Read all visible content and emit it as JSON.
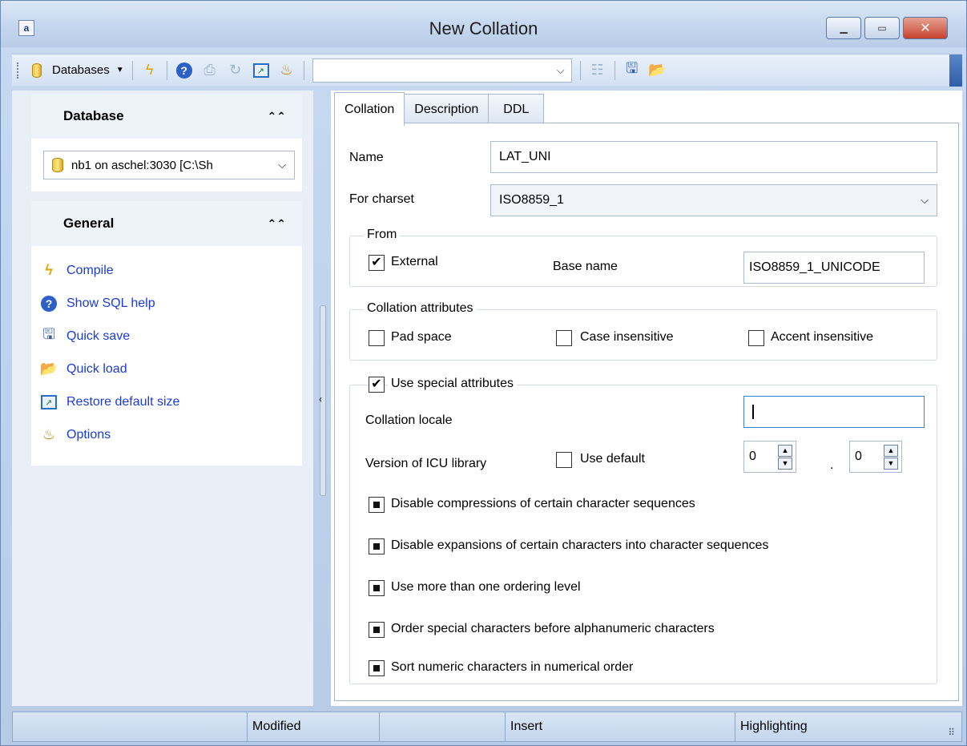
{
  "window": {
    "title": "New Collation"
  },
  "toolbar": {
    "databases_label": "Databases",
    "combo_value": ""
  },
  "left": {
    "database_section": "Database",
    "database_value": "nb1 on aschel:3030 [C:\\Sh",
    "general_section": "General",
    "links": [
      "Compile",
      "Show SQL help",
      "Quick save",
      "Quick load",
      "Restore default size",
      "Options"
    ]
  },
  "tabs": [
    "Collation",
    "Description",
    "DDL"
  ],
  "form": {
    "name_label": "Name",
    "name_value": "LAT_UNI",
    "charset_label": "For charset",
    "charset_value": "ISO8859_1",
    "from_group": "From",
    "external_label": "External",
    "external_checked": true,
    "base_name_label": "Base name",
    "base_name_value": "ISO8859_1_UNICODE",
    "attributes_group": "Collation attributes",
    "pad_space": "Pad space",
    "case_insensitive": "Case insensitive",
    "accent_insensitive": "Accent insensitive",
    "use_special": "Use special attributes",
    "use_special_checked": true,
    "locale_label": "Collation locale",
    "locale_value": "",
    "icu_label": "Version of ICU library",
    "use_default": "Use default",
    "icu_major": "0",
    "icu_dot": ".",
    "icu_minor": "0",
    "options": [
      "Disable compressions of certain character sequences",
      "Disable expansions of certain characters into character sequences",
      "Use more than one ordering level",
      "Order special characters before alphanumeric characters",
      "Sort numeric characters in numerical order"
    ]
  },
  "status": [
    "",
    "Modified",
    "",
    "Insert",
    "Highlighting"
  ]
}
